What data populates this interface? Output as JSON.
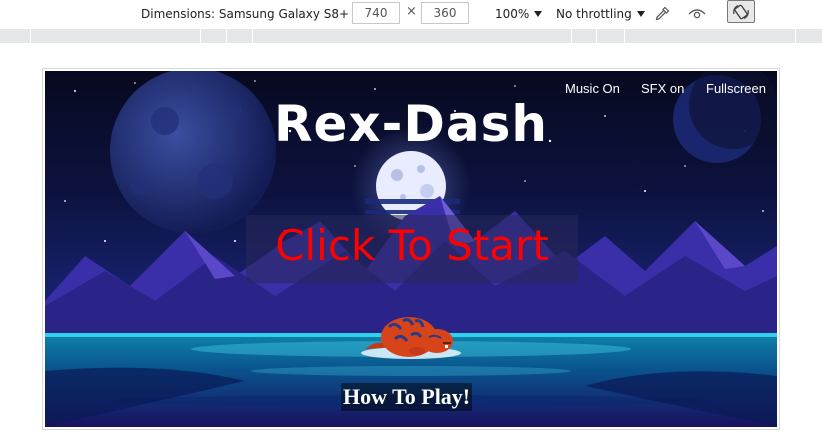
{
  "devtools": {
    "device_label": "Dimensions: Samsung Galaxy S8+",
    "width": "740",
    "height": "360",
    "times": "×",
    "zoom": "100%",
    "throttling": "No throttling",
    "icons": [
      "eyedropper-icon",
      "eye-icon",
      "rotate-icon"
    ]
  },
  "game": {
    "title": "Rex-Dash",
    "start_label": "Click To Start",
    "how_to_play_label": "How To Play!",
    "menu": {
      "music": "Music On",
      "sfx": "SFX on",
      "fullscreen": "Fullscreen"
    },
    "colors": {
      "sky_top": "#07091f",
      "sky_mid": "#16206a",
      "start_text": "#ff0000",
      "water": "#13a6c8",
      "rex_body": "#d8441a"
    }
  }
}
